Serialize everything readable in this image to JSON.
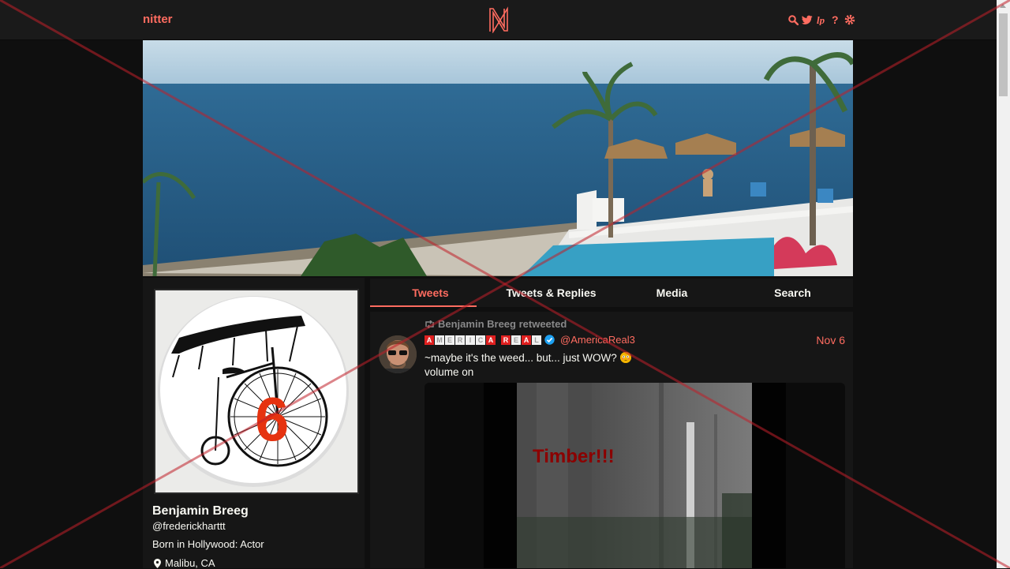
{
  "nav": {
    "brand": "nitter",
    "logo_letter": "N",
    "icons": [
      "search-icon",
      "twitter-bird-icon",
      "rss-icon",
      "help-icon",
      "gear-icon"
    ],
    "accent": "#ff6c60"
  },
  "profile": {
    "name": "Benjamin Breeg",
    "handle": "@frederickharttt",
    "bio": "Born in Hollywood: Actor",
    "location": "Malibu, CA",
    "avatar_number": "6"
  },
  "tabs": [
    {
      "label": "Tweets",
      "active": true
    },
    {
      "label": "Tweets & Replies",
      "active": false
    },
    {
      "label": "Media",
      "active": false
    },
    {
      "label": "Search",
      "active": false
    }
  ],
  "tweet": {
    "retweet_text": "Benjamin Breeg retweeted",
    "fullname_letters": [
      "A",
      "M",
      "E",
      "R",
      "I",
      "C",
      "A",
      " ",
      "R",
      "E",
      "A",
      "L"
    ],
    "handle": "@AmericaReal3",
    "date": "Nov 6",
    "text_line1": "~maybe it's the weed... but...  just WOW?",
    "text_line2": "volume on",
    "media_caption": "Timber!!!"
  },
  "colors": {
    "background": "#0f0f0f",
    "panel": "#161616",
    "navbar": "#1a1a1a",
    "text": "#f8f8f2",
    "muted": "#888889"
  }
}
